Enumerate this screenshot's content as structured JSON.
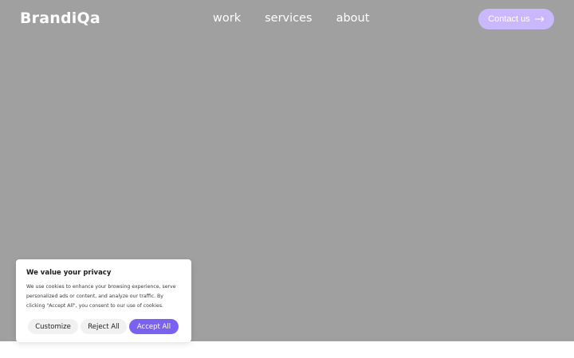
{
  "brand": {
    "logo_text": "BrandiQa"
  },
  "nav": {
    "links": [
      {
        "label": "work"
      },
      {
        "label": "services"
      },
      {
        "label": "about"
      }
    ],
    "contact_label": "Contact us",
    "contact_icon": "arrow-right-icon"
  },
  "cookie_banner": {
    "title": "We value your privacy",
    "text": "We use cookies to enhance your browsing experience, serve personalized ads or content, and analyze our traffic. By clicking \"Accept All\", you consent to our use of cookies.",
    "customize_label": "Customize",
    "reject_label": "Reject All",
    "accept_label": "Accept All"
  },
  "colors": {
    "hero_bg": "#a0a0a0",
    "contact_button": "#c9b8fb",
    "accept_button": "#7b61f0",
    "secondary_button": "#f1f1f1"
  }
}
